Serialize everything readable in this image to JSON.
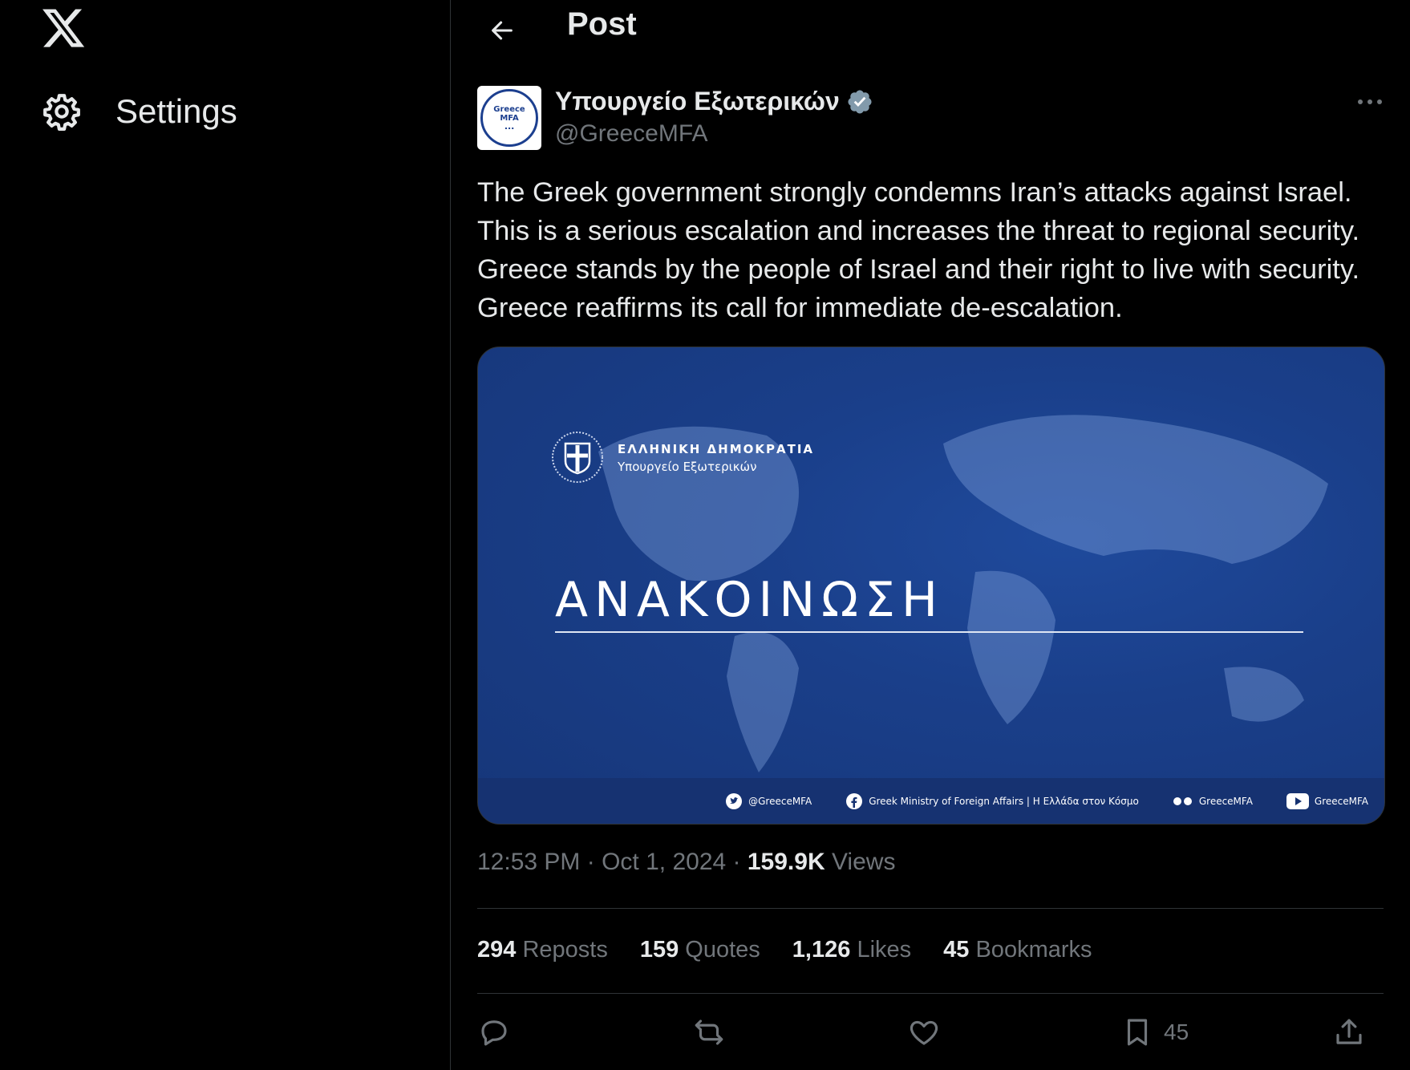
{
  "sidebar": {
    "settings_label": "Settings"
  },
  "header": {
    "title": "Post"
  },
  "post": {
    "author_name": "Υπουργείο Εξωτερικών",
    "author_handle": "@GreeceMFA",
    "avatar_text_line1": "Greece",
    "avatar_text_line2": "MFA",
    "text_lines": [
      "The Greek government strongly condemns Iran’s attacks against Israel.",
      "This is a serious escalation and increases the threat to regional security.",
      "Greece stands by the people of Israel and their right to live with security.",
      "Greece reaffirms its call for immediate de-escalation."
    ],
    "media": {
      "republic": "ΕΛΛΗΝΙΚΗ ΔΗΜΟΚΡΑΤΙΑ",
      "ministry": "Υπουργείο Εξωτερικών",
      "headline": "ΑΝΑΚΟΙΝΩΣΗ",
      "footer_twitter": "@GreeceMFA",
      "footer_facebook": "Greek Ministry of Foreign Affairs | Η Ελλάδα στον Κόσμο",
      "footer_flickr": "GreeceMFA",
      "footer_youtube": "GreeceMFA"
    },
    "time": "12:53 PM",
    "date": "Oct 1, 2024",
    "views_count": "159.9K",
    "views_label": "Views",
    "reposts_count": "294",
    "reposts_label": "Reposts",
    "quotes_count": "159",
    "quotes_label": "Quotes",
    "likes_count": "1,126",
    "likes_label": "Likes",
    "bookmarks_count": "45",
    "bookmarks_label": "Bookmarks",
    "bookmark_action_count": "45"
  },
  "colors": {
    "background": "#000000",
    "text": "#e7e9ea",
    "muted": "#71767b",
    "border": "#2f3336",
    "verified": "#829aab",
    "media_blue": "#1a3f8a"
  },
  "icons": [
    "x-logo-icon",
    "gear-icon",
    "back-arrow-icon",
    "verified-badge-icon",
    "more-icon",
    "reply-icon",
    "repost-icon",
    "like-icon",
    "bookmark-icon",
    "share-icon"
  ]
}
